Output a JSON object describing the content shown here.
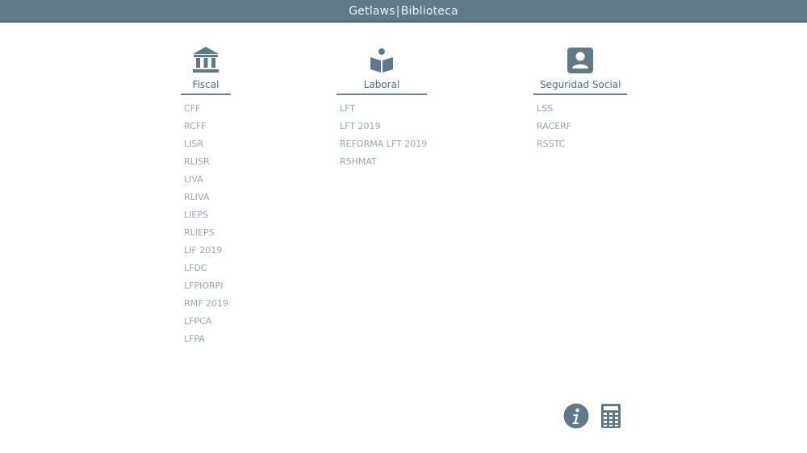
{
  "header": {
    "brand": "Getlaws",
    "separator": "|",
    "section": "Biblioteca"
  },
  "columns": {
    "fiscal": {
      "icon": "bank-icon",
      "label": "Fiscal",
      "items": [
        "CFF",
        "RCFF",
        "LISR",
        "RLISR",
        "LIVA",
        "RLIVA",
        "LIEPS",
        "RLIEPS",
        "LIF 2019",
        "LFDC",
        "LFPIORPI",
        "RMF 2019",
        "LFPCA",
        "LFPA"
      ]
    },
    "laboral": {
      "icon": "reader-book-icon",
      "label": "Laboral",
      "items": [
        "LFT",
        "LFT 2019",
        "REFORMA LFT 2019",
        "RSHMAT"
      ]
    },
    "seguridad": {
      "icon": "contact-card-icon",
      "label": "Seguridad Social",
      "items": [
        "LSS",
        "RACERF",
        "RSSTC"
      ]
    }
  },
  "footer_icons": [
    "info-icon",
    "calculator-icon"
  ],
  "colors": {
    "topbar": "#5f7a89",
    "accent": "#5e7a8a",
    "link": "#9aa8b1"
  }
}
